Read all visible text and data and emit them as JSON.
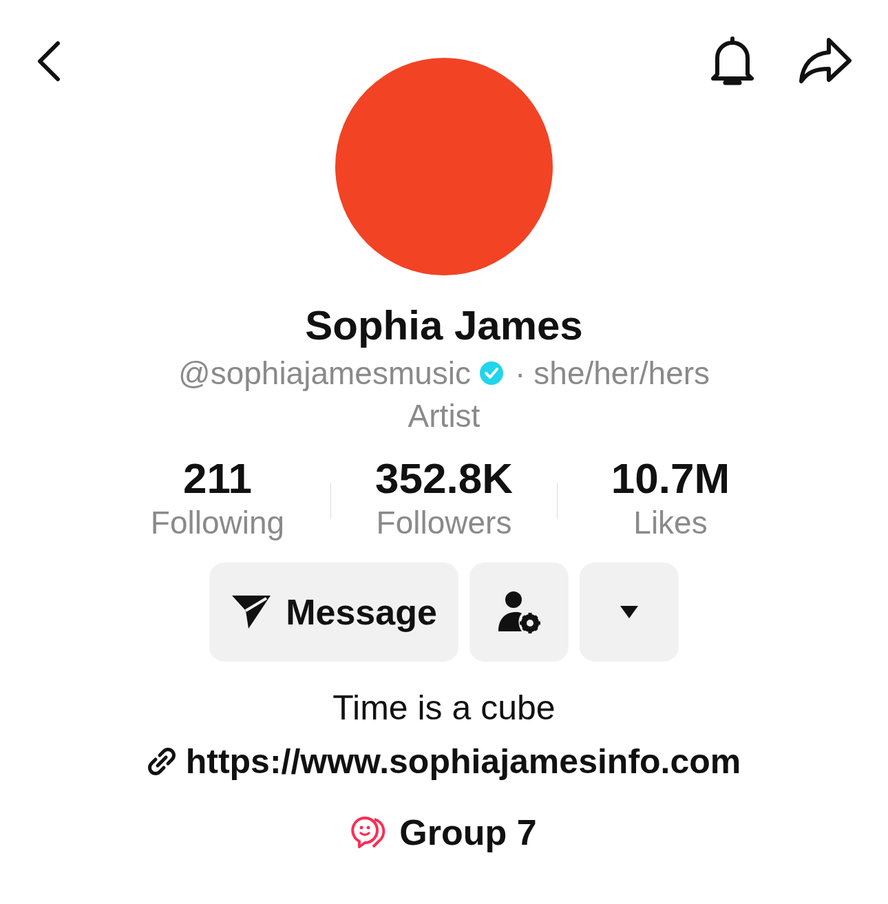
{
  "profile": {
    "name": "Sophia James",
    "handle": "@sophiajamesmusic",
    "verified": true,
    "separator": "·",
    "pronouns": "she/her/hers",
    "category": "Artist"
  },
  "stats": [
    {
      "value": "211",
      "label": "Following"
    },
    {
      "value": "352.8K",
      "label": "Followers"
    },
    {
      "value": "10.7M",
      "label": "Likes"
    }
  ],
  "actions": [
    {
      "kind": "message",
      "label": "Message"
    },
    {
      "kind": "friends"
    },
    {
      "kind": "more"
    }
  ],
  "bio": "Time is a cube",
  "link": "https://www.sophiajamesinfo.com",
  "group": "Group 7"
}
